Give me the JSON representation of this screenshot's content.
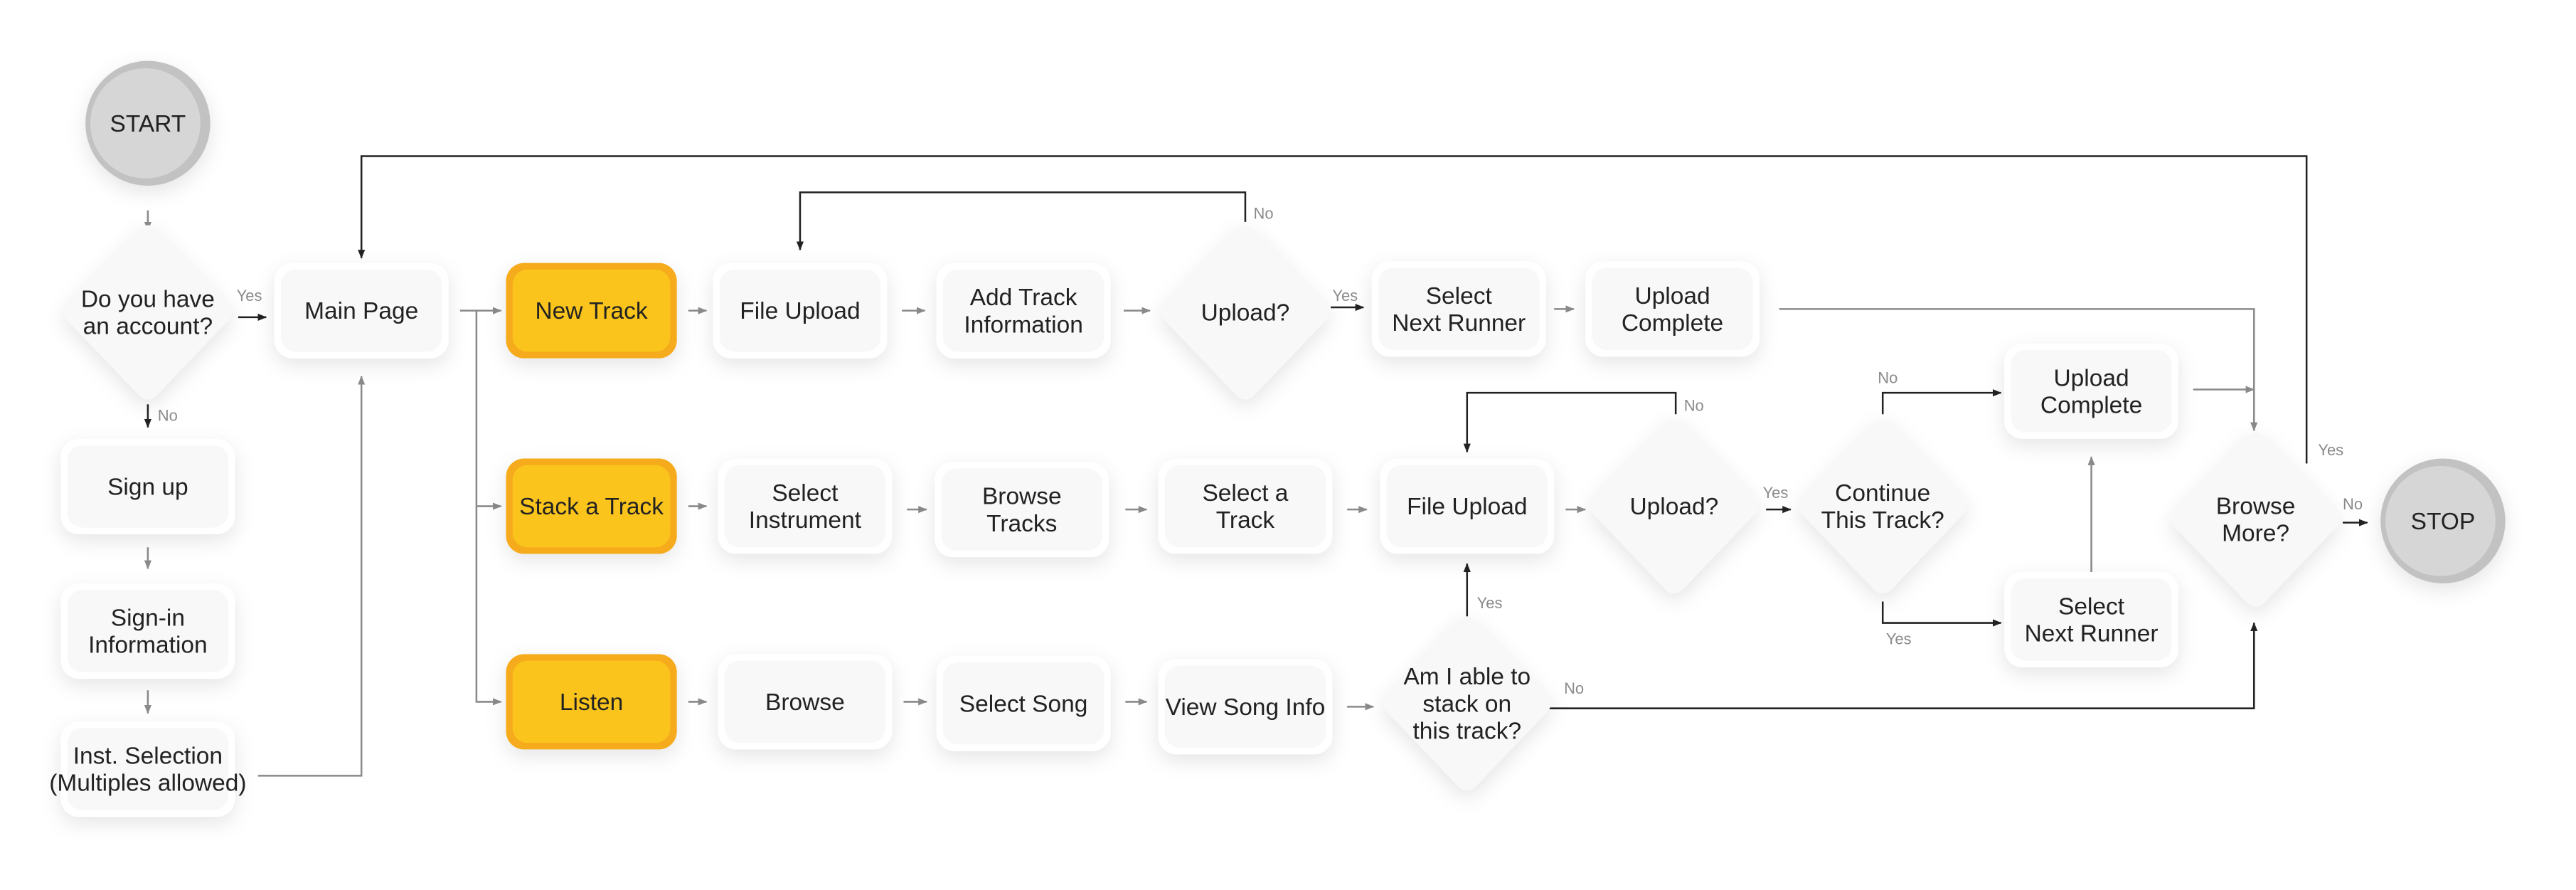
{
  "colors": {
    "box_fill": "#f8f8f8",
    "box_edge": "#ffffff",
    "highlight_fill": "#fac41c",
    "highlight_edge": "#f5ab1c",
    "terminal_fill": "#d6d6d6",
    "terminal_edge": "#c2c2c2",
    "dark_line": "#222222",
    "grey_line": "#8a8a8a"
  },
  "nodes": {
    "start": {
      "shape": "terminal",
      "lines": [
        "START"
      ]
    },
    "has_account": {
      "shape": "decision",
      "lines": [
        "Do you have",
        "an account?"
      ]
    },
    "sign_up": {
      "shape": "process",
      "lines": [
        "Sign up"
      ]
    },
    "sign_in_info": {
      "shape": "process",
      "lines": [
        "Sign-in",
        "Information"
      ]
    },
    "inst_selection": {
      "shape": "process",
      "lines": [
        "Inst. Selection",
        "(Multiples allowed)"
      ]
    },
    "main_page": {
      "shape": "process",
      "lines": [
        "Main Page"
      ]
    },
    "new_track": {
      "shape": "highlight",
      "lines": [
        "New Track"
      ]
    },
    "file_upload_1": {
      "shape": "process",
      "lines": [
        "File Upload"
      ]
    },
    "add_track_info": {
      "shape": "process",
      "lines": [
        "Add Track",
        "Information"
      ]
    },
    "upload_q_1": {
      "shape": "decision",
      "lines": [
        "Upload?"
      ]
    },
    "select_next_runner_1": {
      "shape": "process",
      "lines": [
        "Select",
        "Next Runner"
      ]
    },
    "upload_complete_1": {
      "shape": "process",
      "lines": [
        "Upload",
        "Complete"
      ]
    },
    "stack_a_track": {
      "shape": "highlight",
      "lines": [
        "Stack a Track"
      ]
    },
    "select_instrument": {
      "shape": "process",
      "lines": [
        "Select",
        "Instrument"
      ]
    },
    "browse_tracks": {
      "shape": "process",
      "lines": [
        "Browse",
        "Tracks"
      ]
    },
    "select_a_track": {
      "shape": "process",
      "lines": [
        "Select a",
        "Track"
      ]
    },
    "file_upload_2": {
      "shape": "process",
      "lines": [
        "File Upload"
      ]
    },
    "upload_q_2": {
      "shape": "decision",
      "lines": [
        "Upload?"
      ]
    },
    "continue_track_q": {
      "shape": "decision",
      "lines": [
        "Continue",
        "This Track?"
      ]
    },
    "upload_complete_2": {
      "shape": "process",
      "lines": [
        "Upload",
        "Complete"
      ]
    },
    "select_next_runner_2": {
      "shape": "process",
      "lines": [
        "Select",
        "Next Runner"
      ]
    },
    "browse_more_q": {
      "shape": "decision",
      "lines": [
        "Browse",
        "More?"
      ]
    },
    "stop": {
      "shape": "terminal",
      "lines": [
        "STOP"
      ]
    },
    "listen": {
      "shape": "highlight",
      "lines": [
        "Listen"
      ]
    },
    "browse": {
      "shape": "process",
      "lines": [
        "Browse"
      ]
    },
    "select_song": {
      "shape": "process",
      "lines": [
        "Select Song"
      ]
    },
    "view_song_info": {
      "shape": "process",
      "lines": [
        "View Song Info"
      ]
    },
    "able_to_stack_q": {
      "shape": "decision",
      "lines": [
        "Am I able to",
        "stack on",
        "this track?"
      ]
    }
  },
  "edge_labels": {
    "has_account_yes": "Yes",
    "has_account_no": "No",
    "upload_1_no": "No",
    "upload_1_yes": "Yes",
    "upload_2_no": "No",
    "upload_2_yes": "Yes",
    "continue_no": "No",
    "continue_yes": "Yes",
    "able_yes": "Yes",
    "able_no": "No",
    "browse_more_yes": "Yes",
    "browse_more_no": "No"
  }
}
